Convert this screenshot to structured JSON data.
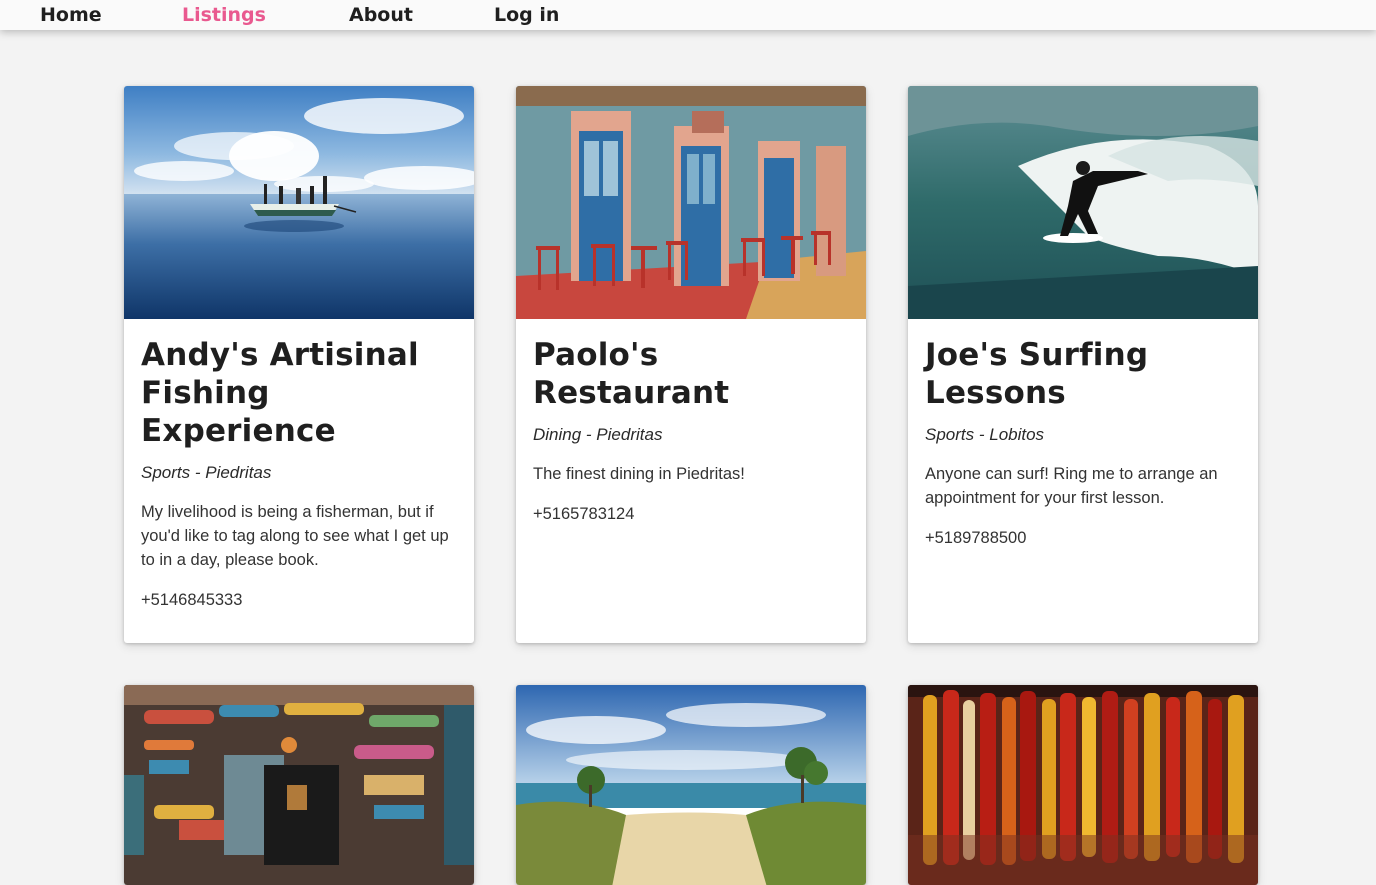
{
  "nav": {
    "home": "Home",
    "listings": "Listings",
    "about": "About",
    "login": "Log in",
    "active_color": "#e9598f"
  },
  "listings": [
    {
      "title": "Andy's Artisinal Fishing Experience",
      "category": "Sports - Piedritas",
      "description": "My livelihood is being a fisherman, but if you'd like to tag along to see what I get up to in a day, please book.",
      "phone": "+5146845333",
      "image": "fishing-boat-photo"
    },
    {
      "title": "Paolo's Restaurant",
      "category": "Dining - Piedritas",
      "description": "The finest dining in Piedritas!",
      "phone": "+5165783124",
      "image": "restaurant-facade-photo"
    },
    {
      "title": "Joe's Surfing Lessons",
      "category": "Sports - Lobitos",
      "description": "Anyone can surf! Ring me to arrange an appointment for your first lesson.",
      "phone": "+5189788500",
      "image": "surfer-photo"
    },
    {
      "image": "surf-shack-photo"
    },
    {
      "image": "beach-dunes-photo"
    },
    {
      "image": "chili-market-photo"
    }
  ]
}
